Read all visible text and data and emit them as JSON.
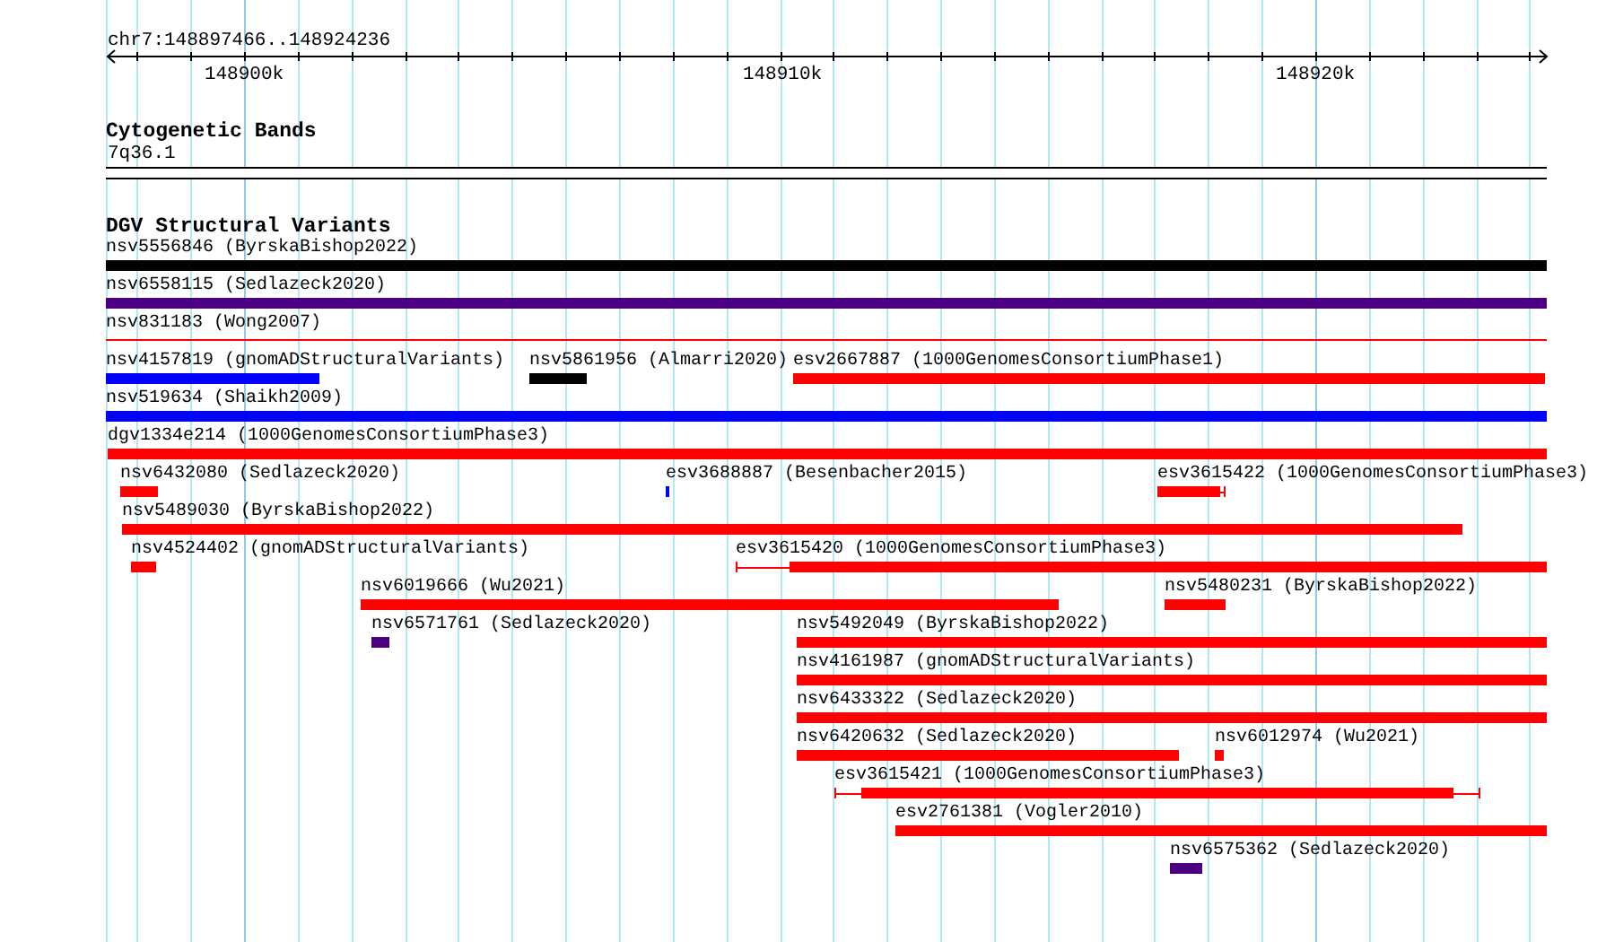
{
  "ruler": {
    "position": "chr7:148897466..148924236",
    "ticks": [
      "148900k",
      "148910k",
      "148920k"
    ]
  },
  "tracks": [
    {
      "kind": "bands",
      "title": "Cytogenetic Bands",
      "band": "7q36.1"
    },
    {
      "kind": "features",
      "title": "DGV Structural Variants",
      "rows": [
        [
          {
            "label": "nsv5556846 (ByrskaBishop2022)",
            "color": "#000000",
            "kind": "block"
          }
        ],
        [
          {
            "label": "nsv6558115 (Sedlazeck2020)",
            "color": "#4b0082",
            "kind": "block"
          }
        ],
        [
          {
            "label": "nsv831183 (Wong2007)",
            "color": "#ff0000",
            "kind": "thin"
          }
        ],
        [
          {
            "label": "nsv4157819 (gnomADStructuralVariants)",
            "color": "#0000ff",
            "kind": "block"
          },
          {
            "label": "nsv5861956 (Almarri2020)",
            "color": "#000000",
            "kind": "block"
          },
          {
            "label": "esv2667887 (1000GenomesConsortiumPhase1)",
            "color": "#ff0000",
            "kind": "block"
          }
        ],
        [
          {
            "label": "nsv519634 (Shaikh2009)",
            "color": "#0000ff",
            "kind": "block"
          }
        ],
        [
          {
            "label": "dgv1334e214 (1000GenomesConsortiumPhase3)",
            "color": "#ff0000",
            "kind": "block"
          }
        ],
        [
          {
            "label": "nsv6432080 (Sedlazeck2020)",
            "color": "#ff0000",
            "kind": "block"
          },
          {
            "label": "esv3688887 (Besenbacher2015)",
            "color": "#0000ff",
            "kind": "block"
          },
          {
            "label": "esv3615422 (1000GenomesConsortiumPhase3)",
            "color": "#ff0000",
            "kind": "flanked"
          }
        ],
        [
          {
            "label": "nsv5489030 (ByrskaBishop2022)",
            "color": "#ff0000",
            "kind": "block"
          }
        ],
        [
          {
            "label": "nsv4524402 (gnomADStructuralVariants)",
            "color": "#ff0000",
            "kind": "block"
          },
          {
            "label": "esv3615420 (1000GenomesConsortiumPhase3)",
            "color": "#ff0000",
            "kind": "flanked"
          }
        ],
        [
          {
            "label": "nsv6019666 (Wu2021)",
            "color": "#ff0000",
            "kind": "block"
          },
          {
            "label": "nsv5480231 (ByrskaBishop2022)",
            "color": "#ff0000",
            "kind": "block"
          }
        ],
        [
          {
            "label": "nsv6571761 (Sedlazeck2020)",
            "color": "#4b0082",
            "kind": "block"
          },
          {
            "label": "nsv5492049 (ByrskaBishop2022)",
            "color": "#ff0000",
            "kind": "block"
          }
        ],
        [
          {
            "label": "nsv4161987 (gnomADStructuralVariants)",
            "color": "#ff0000",
            "kind": "block"
          }
        ],
        [
          {
            "label": "nsv6433322 (Sedlazeck2020)",
            "color": "#ff0000",
            "kind": "block"
          }
        ],
        [
          {
            "label": "nsv6420632 (Sedlazeck2020)",
            "color": "#ff0000",
            "kind": "block"
          },
          {
            "label": "nsv6012974 (Wu2021)",
            "color": "#ff0000",
            "kind": "block"
          }
        ],
        [
          {
            "label": "esv3615421 (1000GenomesConsortiumPhase3)",
            "color": "#ff0000",
            "kind": "flanked"
          }
        ],
        [
          {
            "label": "esv2761381 (Vogler2010)",
            "color": "#ff0000",
            "kind": "block"
          }
        ],
        [
          {
            "label": "nsv6575362 (Sedlazeck2020)",
            "color": "#4b0082",
            "kind": "block"
          }
        ]
      ]
    }
  ]
}
